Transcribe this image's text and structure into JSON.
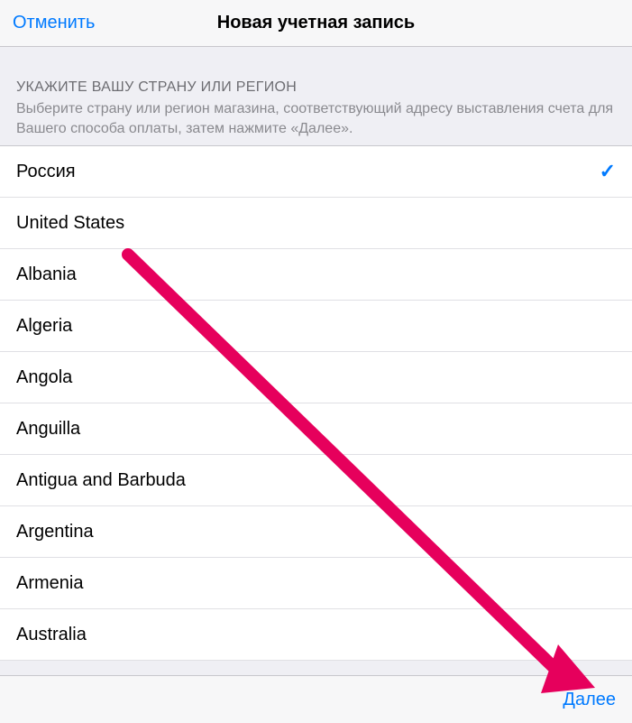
{
  "navbar": {
    "cancel": "Отменить",
    "title": "Новая учетная запись"
  },
  "section": {
    "title": "УКАЖИТЕ ВАШУ СТРАНУ ИЛИ РЕГИОН",
    "description": "Выберите страну или регион магазина, соответствующий адресу выставления счета для Вашего способа оплаты, затем нажмите «Далее»."
  },
  "countries": [
    {
      "name": "Россия",
      "selected": true
    },
    {
      "name": "United States",
      "selected": false
    },
    {
      "name": "Albania",
      "selected": false
    },
    {
      "name": "Algeria",
      "selected": false
    },
    {
      "name": "Angola",
      "selected": false
    },
    {
      "name": "Anguilla",
      "selected": false
    },
    {
      "name": "Antigua and Barbuda",
      "selected": false
    },
    {
      "name": "Argentina",
      "selected": false
    },
    {
      "name": "Armenia",
      "selected": false
    },
    {
      "name": "Australia",
      "selected": false
    }
  ],
  "toolbar": {
    "next": "Далее"
  },
  "annotation": {
    "arrow_color": "#e91e63"
  }
}
